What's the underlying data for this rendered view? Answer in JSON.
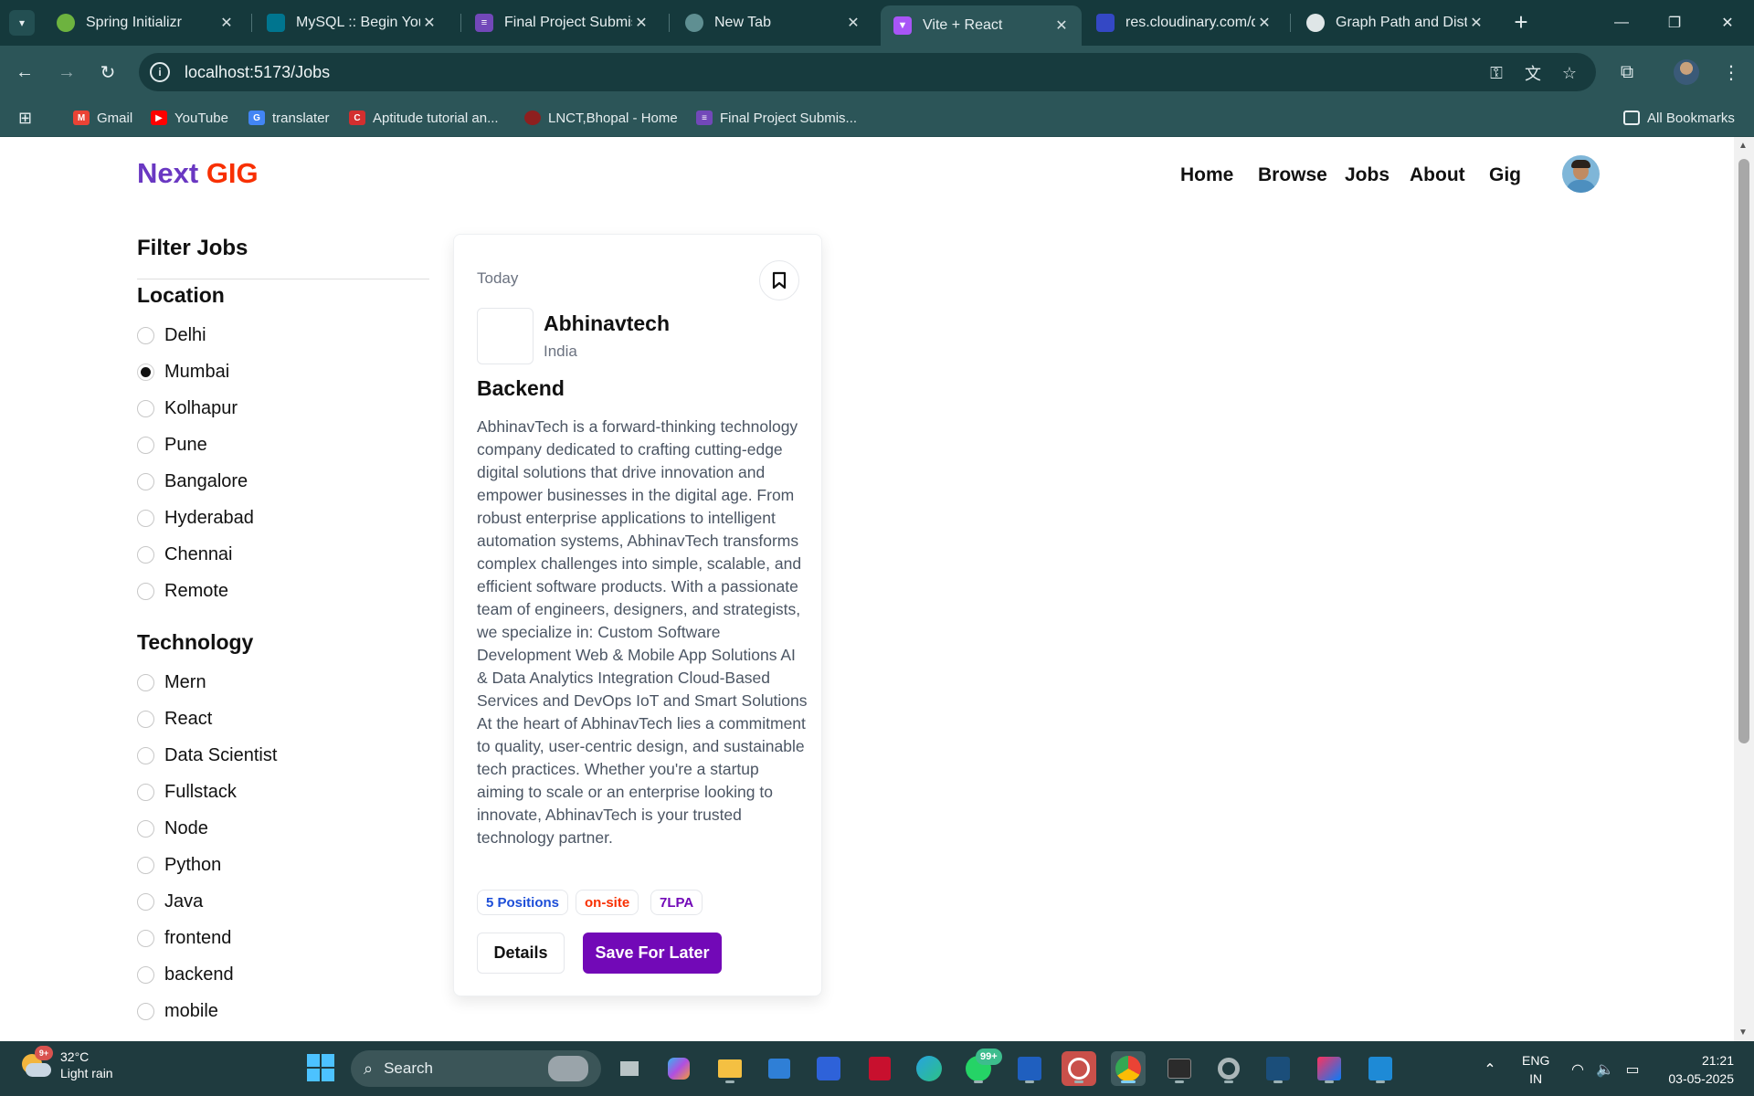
{
  "browser": {
    "tabs": [
      {
        "title": "Spring Initializr",
        "icon": "spring-icon",
        "color": "#6db33f",
        "active": false
      },
      {
        "title": "MySQL :: Begin Your I",
        "icon": "mysql-icon",
        "color": "#00758f",
        "active": false
      },
      {
        "title": "Final Project Submiss",
        "icon": "form-icon",
        "color": "#7248b9",
        "active": false
      },
      {
        "title": "New Tab",
        "icon": "chrome-icon",
        "color": "#5f8f92",
        "active": false
      },
      {
        "title": "Vite + React",
        "icon": "vite-icon",
        "color": "#a855f7",
        "active": true
      },
      {
        "title": "res.cloudinary.com/d",
        "icon": "cloudinary-icon",
        "color": "#3448c5",
        "active": false
      },
      {
        "title": "Graph Path and Dista",
        "icon": "openai-icon",
        "color": "#dfe6e7",
        "active": false
      }
    ],
    "url": "localhost:5173/Jobs",
    "bookmarks": [
      {
        "label": "Gmail",
        "icon": "gmail-icon",
        "color": "#ea4335"
      },
      {
        "label": "YouTube",
        "icon": "youtube-icon",
        "color": "#ff0000"
      },
      {
        "label": "translater",
        "icon": "google-translate-icon",
        "color": "#4285f4"
      },
      {
        "label": "Aptitude tutorial an...",
        "icon": "indiabix-icon",
        "color": "#d32f2f"
      },
      {
        "label": "LNCT,Bhopal - Home",
        "icon": "lnct-icon",
        "color": "#8e1f1f"
      },
      {
        "label": "Final Project Submis...",
        "icon": "form-icon",
        "color": "#7248b9"
      }
    ],
    "all_bookmarks": "All Bookmarks"
  },
  "site": {
    "logo_part1": "Next ",
    "logo_part2": "GIG",
    "nav": [
      "Home",
      "Browse",
      "Jobs",
      "About",
      "Gig"
    ],
    "colors": {
      "purple": "#6a38c2",
      "orange": "#f83002",
      "button": "#7209b7"
    }
  },
  "filters": {
    "title": "Filter Jobs",
    "location": {
      "title": "Location",
      "options": [
        "Delhi",
        "Mumbai",
        "Kolhapur",
        "Pune",
        "Bangalore",
        "Hyderabad",
        "Chennai",
        "Remote"
      ],
      "selected": "Mumbai"
    },
    "technology": {
      "title": "Technology",
      "options": [
        "Mern",
        "React",
        "Data Scientist",
        "Fullstack",
        "Node",
        "Python",
        "Java",
        "frontend",
        "backend",
        "mobile"
      ]
    }
  },
  "job": {
    "posted": "Today",
    "company": "Abhinavtech",
    "country": "India",
    "role": "Backend",
    "description": "AbhinavTech is a forward-thinking technology company dedicated to crafting cutting-edge digital solutions that drive innovation and empower businesses in the digital age. From robust enterprise applications to intelligent automation systems, AbhinavTech transforms complex challenges into simple, scalable, and efficient software products. With a passionate team of engineers, designers, and strategists, we specialize in: Custom Software Development Web & Mobile App Solutions AI & Data Analytics Integration Cloud-Based Services and DevOps IoT and Smart Solutions At the heart of AbhinavTech lies a commitment to quality, user-centric design, and sustainable tech practices. Whether you're a startup aiming to scale or an enterprise looking to innovate, AbhinavTech is your trusted technology partner.",
    "badges": [
      {
        "label": "5 Positions",
        "color": "#1d4ed8"
      },
      {
        "label": "on-site",
        "color": "#f83002"
      },
      {
        "label": "7LPA",
        "color": "#7209b7"
      }
    ],
    "details_label": "Details",
    "save_label": "Save For Later"
  },
  "taskbar": {
    "weather_temp": "32°C",
    "weather_desc": "Light rain",
    "weather_badge": "9+",
    "search_placeholder": "Search",
    "whatsapp_badge": "99+",
    "lang_line1": "ENG",
    "lang_line2": "IN",
    "time": "21:21",
    "date": "03-05-2025"
  }
}
